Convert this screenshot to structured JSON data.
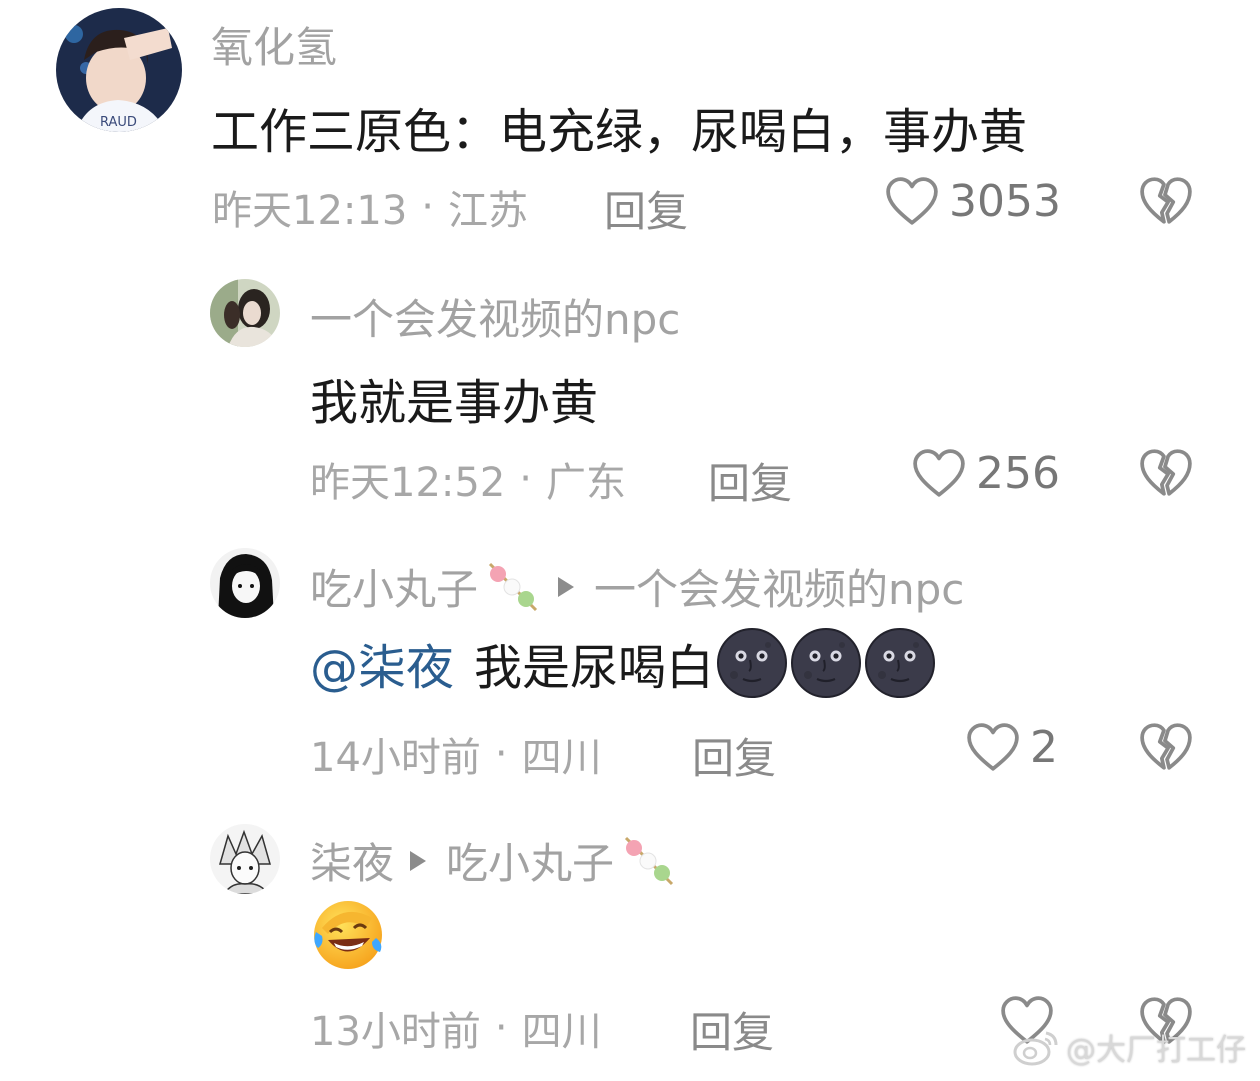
{
  "comments": [
    {
      "username": "氧化氢",
      "text": "工作三原色：电充绿，尿喝白，事办黄",
      "time": "昨天12:13",
      "location": "江苏",
      "reply_label": "回复",
      "likes": "3053"
    },
    {
      "username": "一个会发视频的npc",
      "text": "我就是事办黄",
      "time": "昨天12:52",
      "location": "广东",
      "reply_label": "回复",
      "likes": "256"
    },
    {
      "username": "吃小丸子",
      "reply_to": "一个会发视频的npc",
      "mention": "@柒夜",
      "text": "我是尿喝白",
      "time": "14小时前",
      "location": "四川",
      "reply_label": "回复",
      "likes": "2"
    },
    {
      "username": "柒夜",
      "reply_to": "吃小丸子",
      "time": "13小时前",
      "location": "四川",
      "reply_label": "回复",
      "likes": ""
    }
  ],
  "meta_separator": "·",
  "watermark": "@大厂打工仔",
  "icons": {
    "like": "heart-outline-icon",
    "dislike": "broken-heart-icon",
    "reply_arrow": "play-triangle-icon",
    "emoji_moon": "new-moon-face-emoji",
    "emoji_laugh": "rolling-laughing-emoji",
    "emoji_dango": "dango-emoji",
    "watermark_logo": "weibo-logo-icon"
  }
}
